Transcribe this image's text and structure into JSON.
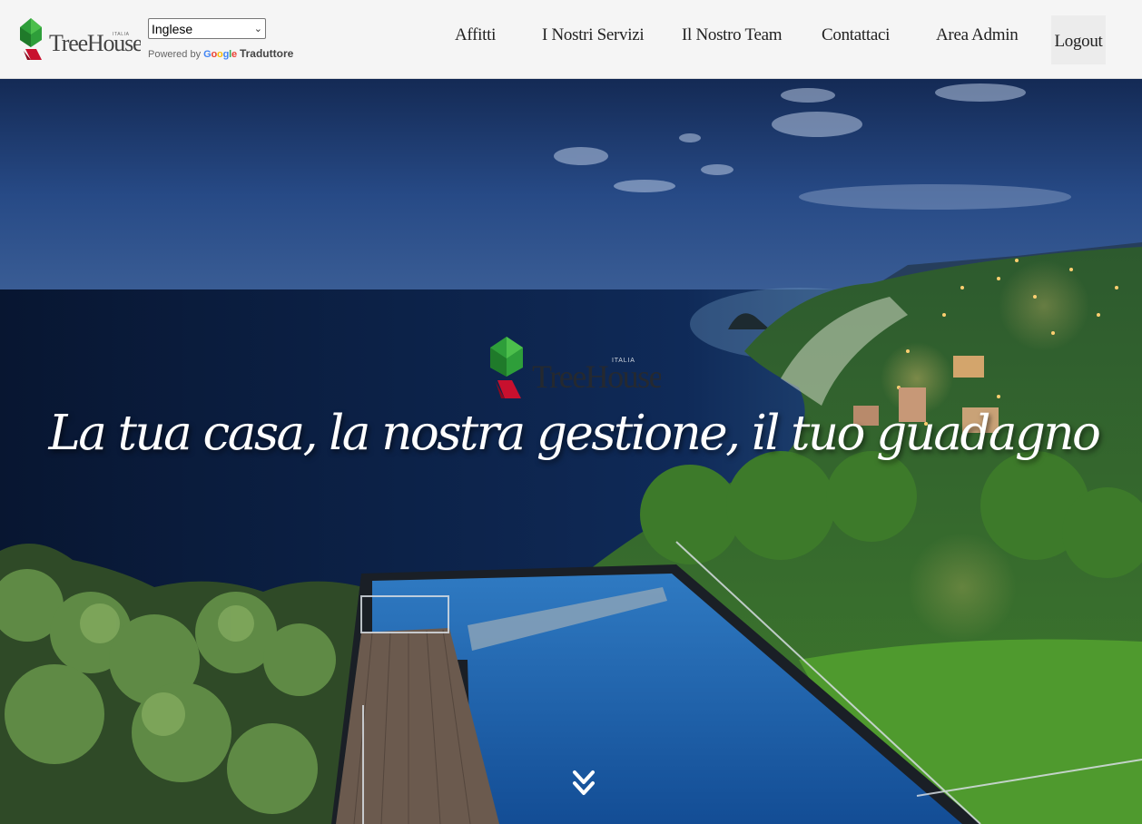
{
  "header": {
    "logo_text": "TreeHouse",
    "logo_subtext": "ITALIA",
    "translate": {
      "selected_language": "Inglese",
      "powered_by": "Powered by",
      "google": "Google",
      "translator": "Traduttore"
    },
    "nav": [
      {
        "label": "Affitti"
      },
      {
        "label": "I Nostri Servizi"
      },
      {
        "label": "Il Nostro Team"
      },
      {
        "label": "Contattaci"
      },
      {
        "label": "Area Admin"
      }
    ],
    "logout_label": "Logout"
  },
  "hero": {
    "tagline": "La tua casa, la nostra gestione, il tuo guadagno",
    "logo_text": "TreeHouse",
    "logo_subtext": "ITALIA",
    "scroll_icon": "double-chevron-down-icon"
  },
  "colors": {
    "brand_green": "#2e9e3a",
    "brand_red": "#c8102e",
    "header_bg": "#f5f5f5",
    "sky": "#1c3a6e",
    "sea": "#0c1f44",
    "pool": "#1f5fa8"
  }
}
